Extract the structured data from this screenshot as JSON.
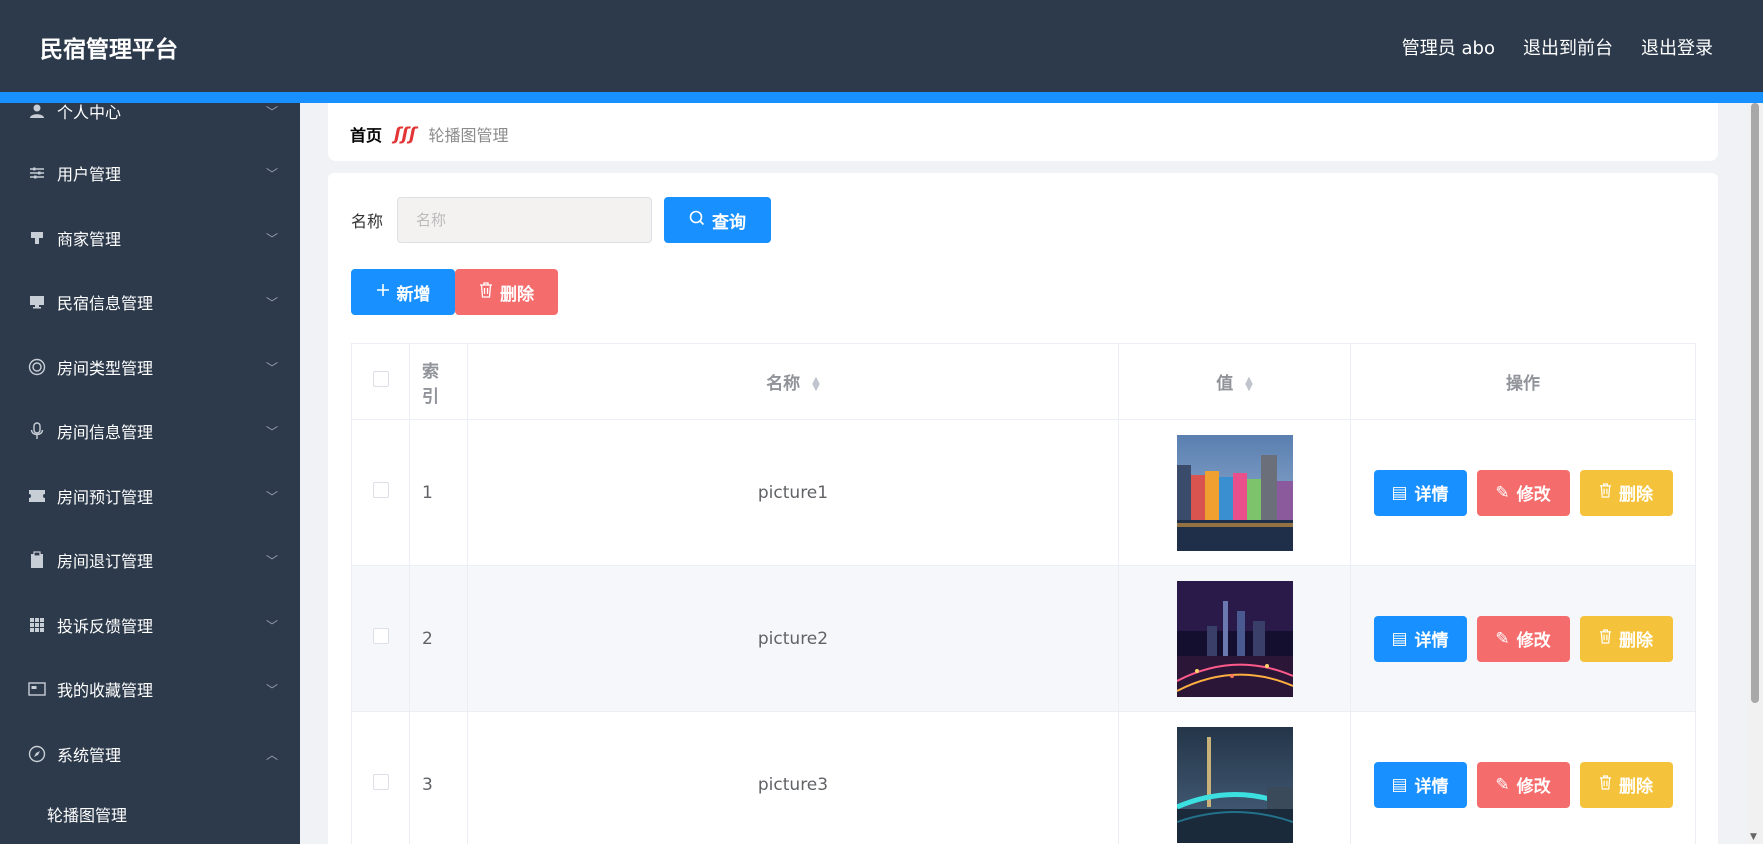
{
  "header": {
    "title": "民宿管理平台",
    "admin": "管理员 abo",
    "to_front": "退出到前台",
    "logout": "退出登录"
  },
  "sidebar": {
    "items": [
      {
        "label": "个人中心",
        "icon": "user-icon"
      },
      {
        "label": "用户管理",
        "icon": "sliders-icon"
      },
      {
        "label": "商家管理",
        "icon": "stamp-icon"
      },
      {
        "label": "民宿信息管理",
        "icon": "monitor-icon"
      },
      {
        "label": "房间类型管理",
        "icon": "target-icon"
      },
      {
        "label": "房间信息管理",
        "icon": "microphone-icon"
      },
      {
        "label": "房间预订管理",
        "icon": "ticket-icon"
      },
      {
        "label": "房间退订管理",
        "icon": "clipboard-icon"
      },
      {
        "label": "投诉反馈管理",
        "icon": "grid-icon"
      },
      {
        "label": "我的收藏管理",
        "icon": "card-icon"
      },
      {
        "label": "系统管理",
        "icon": "compass-icon"
      }
    ],
    "subitem": "轮播图管理"
  },
  "breadcrumb": {
    "home": "首页",
    "current": "轮播图管理"
  },
  "search": {
    "label": "名称",
    "placeholder": "名称",
    "button": "查询"
  },
  "actions": {
    "add": "新增",
    "delete": "删除"
  },
  "table": {
    "headers": {
      "index_line1": "索",
      "index_line2": "引",
      "name": "名称",
      "value": "值",
      "ops": "操作"
    },
    "rows": [
      {
        "index": "1",
        "name": "picture1"
      },
      {
        "index": "2",
        "name": "picture2"
      },
      {
        "index": "3",
        "name": "picture3"
      }
    ],
    "ops": {
      "detail": "详情",
      "edit": "修改",
      "delete": "删除"
    }
  },
  "colors": {
    "header_bg": "#2d3a4b",
    "accent": "#1890ff",
    "danger": "#f56c6c",
    "warning": "#f5c33b"
  }
}
